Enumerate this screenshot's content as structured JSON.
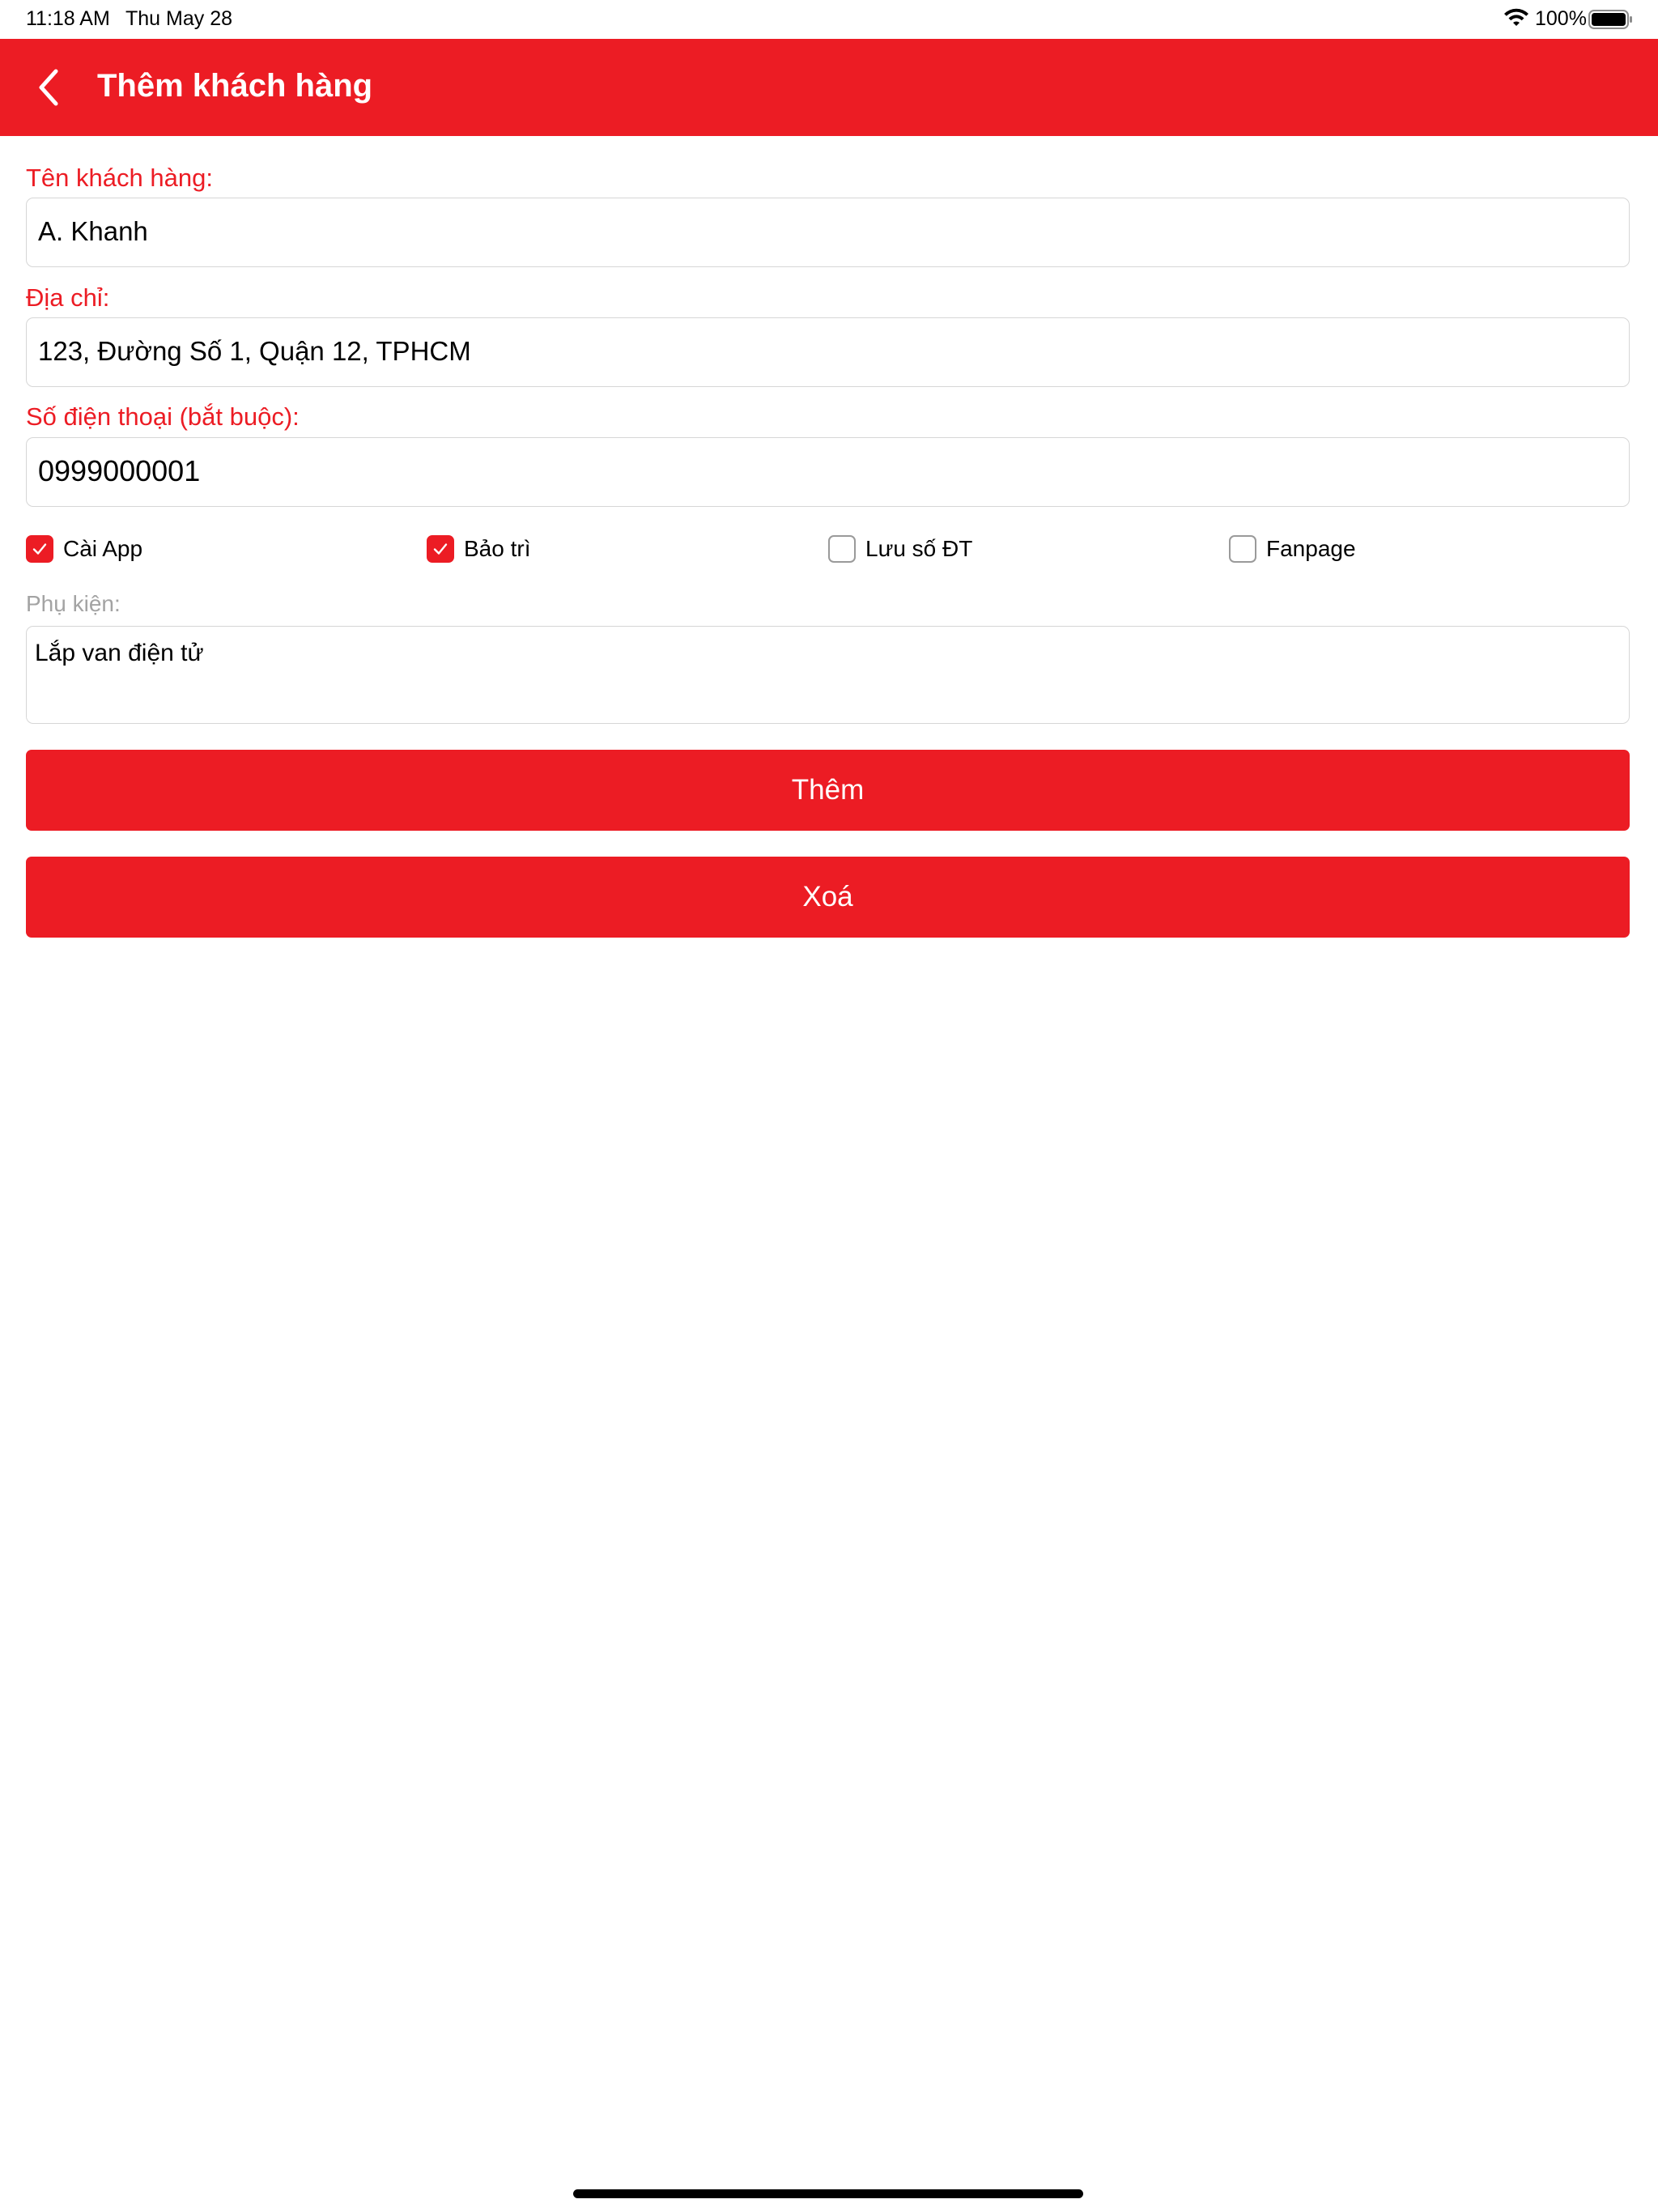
{
  "status_bar": {
    "time": "11:18 AM",
    "date": "Thu May 28",
    "battery": "100%"
  },
  "navbar": {
    "title": "Thêm khách hàng",
    "back_icon": "chevron-left-icon"
  },
  "form": {
    "name": {
      "label": "Tên khách hàng:",
      "value": "A. Khanh"
    },
    "address": {
      "label": "Địa chỉ:",
      "value": "123, Đường Số 1, Quận 12, TPHCM"
    },
    "phone": {
      "label": "Số điện thoại (bắt buộc):",
      "value": "0999000001"
    },
    "options": [
      {
        "label": "Cài App",
        "checked": true
      },
      {
        "label": "Bảo trì",
        "checked": true
      },
      {
        "label": "Lưu số ĐT",
        "checked": false
      },
      {
        "label": "Fanpage",
        "checked": false
      }
    ],
    "accessories": {
      "label": "Phụ kiện:",
      "value": "Lắp van điện tử"
    }
  },
  "buttons": {
    "add_label": "Thêm",
    "delete_label": "Xoá"
  },
  "colors": {
    "accent": "#ec1c24",
    "border": "#d6d6d6",
    "muted_label": "#a3a3a3"
  }
}
